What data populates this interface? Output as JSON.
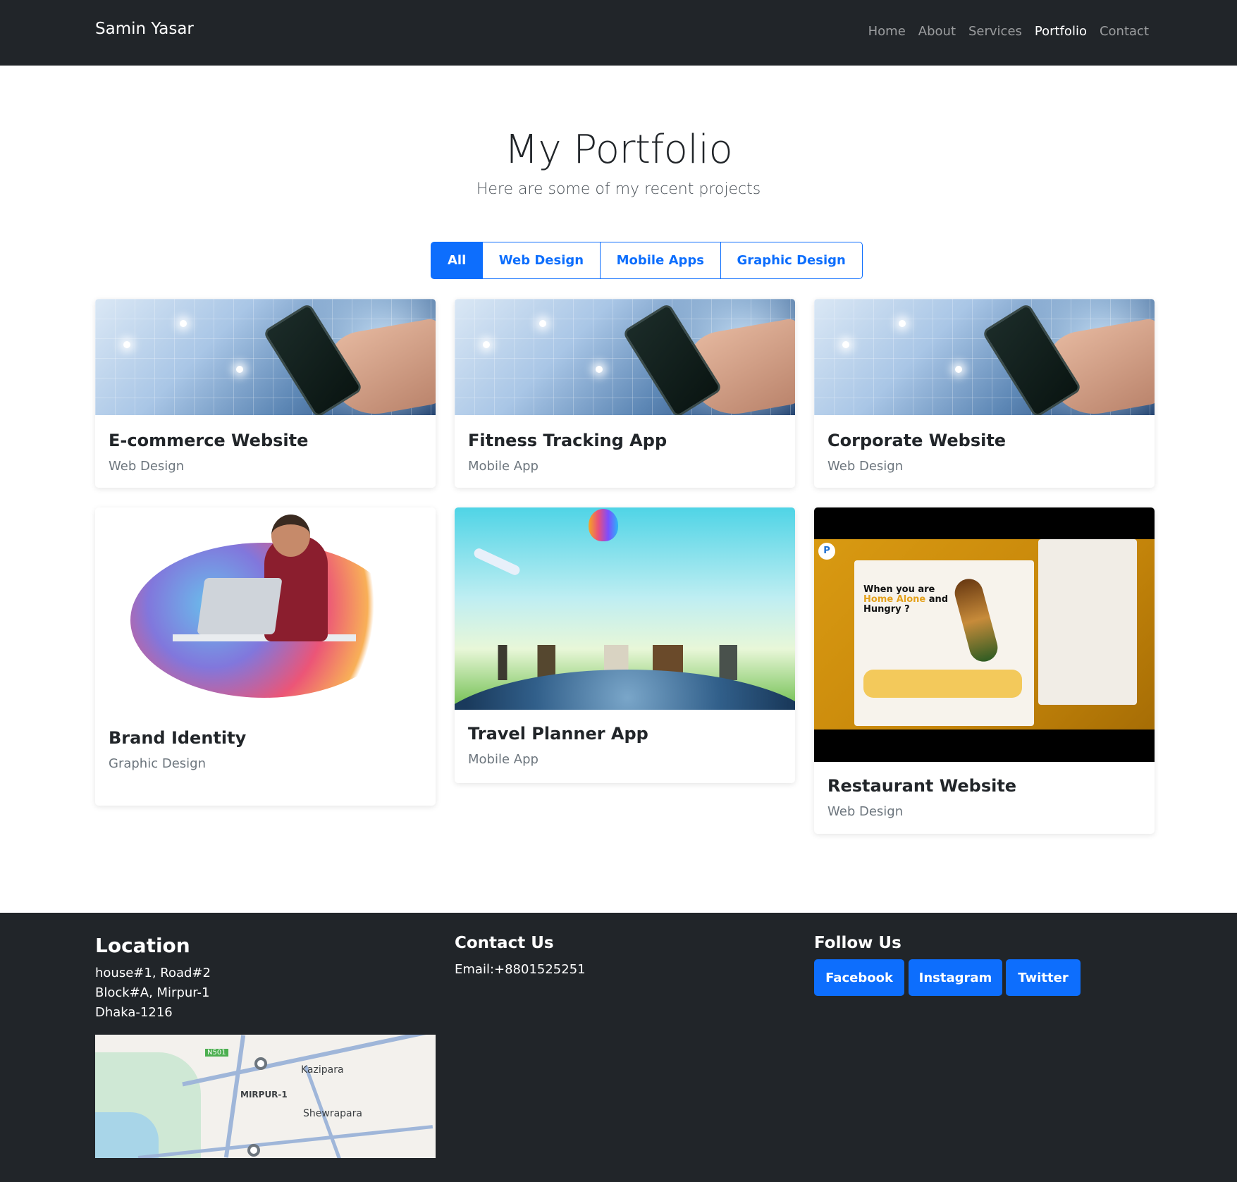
{
  "navbar": {
    "brand": "Samin Yasar",
    "links": [
      "Home",
      "About",
      "Services",
      "Portfolio",
      "Contact"
    ],
    "active": "Portfolio"
  },
  "hero": {
    "title": "My Portfolio",
    "subtitle": "Here are some of my recent projects"
  },
  "filters": [
    "All",
    "Web Design",
    "Mobile Apps",
    "Graphic Design"
  ],
  "active_filter": "All",
  "projects": [
    {
      "title": "E-commerce Website",
      "category": "Web Design"
    },
    {
      "title": "Fitness Tracking App",
      "category": "Mobile App"
    },
    {
      "title": "Corporate Website",
      "category": "Web Design"
    },
    {
      "title": "Brand Identity",
      "category": "Graphic Design"
    },
    {
      "title": "Travel Planner App",
      "category": "Mobile App"
    },
    {
      "title": "Restaurant Website",
      "category": "Web Design"
    }
  ],
  "restaurant_mock": {
    "headline_1": "When you are",
    "headline_2": "Home Alone",
    "headline_3": "and",
    "headline_4": "Hungry ?",
    "logo": "P"
  },
  "footer": {
    "location": {
      "heading": "Location",
      "lines": [
        "house#1, Road#2",
        "Block#A, Mirpur-1",
        "Dhaka-1216"
      ]
    },
    "contact": {
      "heading": "Contact Us",
      "email": "Email:+8801525251"
    },
    "follow": {
      "heading": "Follow Us",
      "buttons": [
        "Facebook",
        "Instagram",
        "Twitter"
      ]
    },
    "map_labels": [
      "Kazipara",
      "Shewrapara",
      "MIRPUR-1",
      "N501"
    ]
  },
  "colors": {
    "nav_bg": "#212529",
    "primary": "#0d6efd",
    "muted": "#6c757d"
  }
}
